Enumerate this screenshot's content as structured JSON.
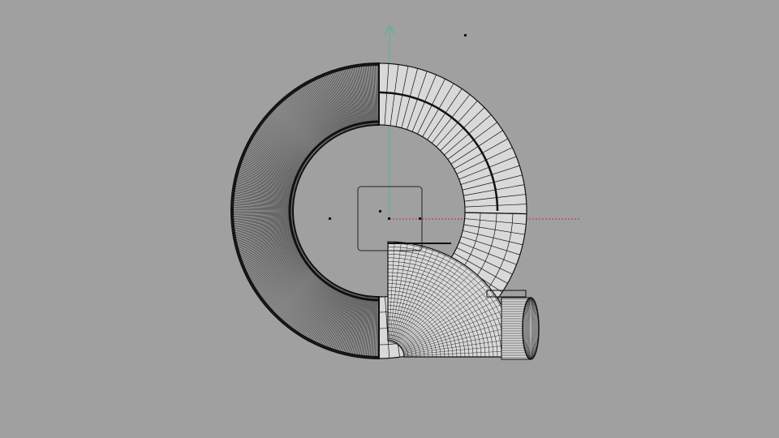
{
  "viewport": {
    "background": "#a0a0a0",
    "wire_color": "#111111",
    "face_fill": "#d9d9d9",
    "axis_x_color": "#cc2a2a",
    "axis_y_color": "#3bbf8f",
    "icons": [
      "axis-x-icon",
      "axis-y-icon",
      "selection-box-icon",
      "vertex-dot-icon"
    ]
  }
}
